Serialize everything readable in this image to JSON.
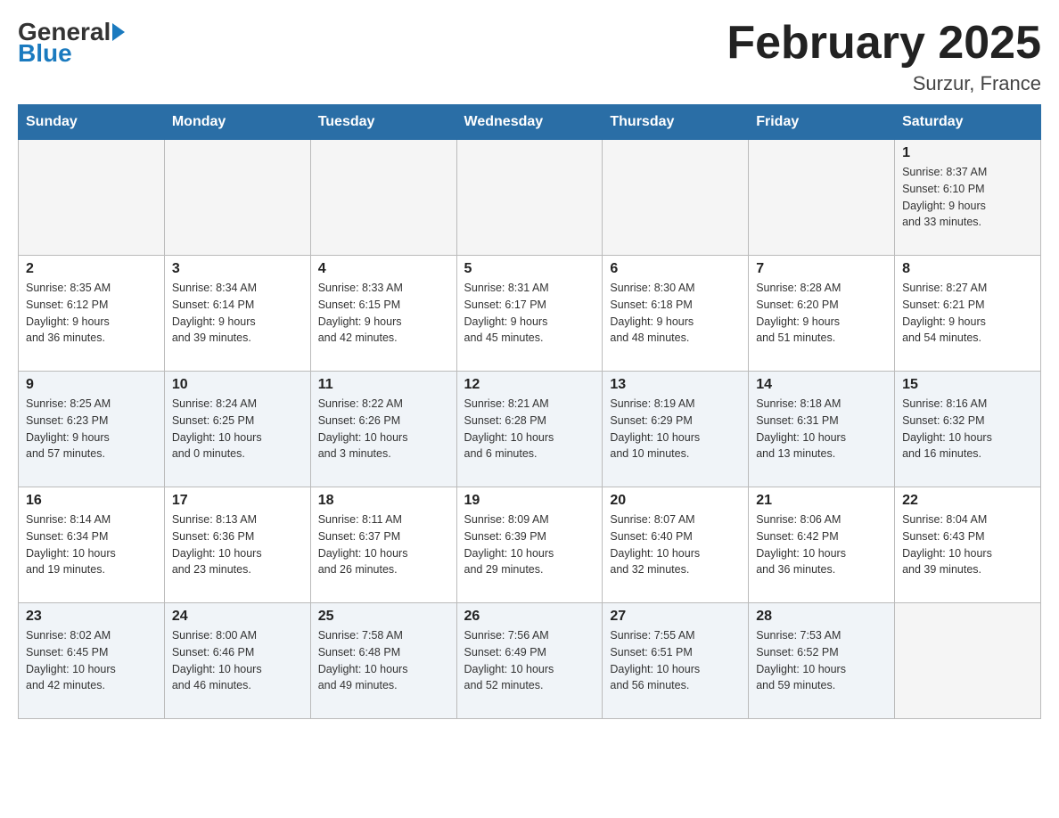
{
  "logo": {
    "general": "General",
    "blue": "Blue"
  },
  "title": "February 2025",
  "subtitle": "Surzur, France",
  "days_of_week": [
    "Sunday",
    "Monday",
    "Tuesday",
    "Wednesday",
    "Thursday",
    "Friday",
    "Saturday"
  ],
  "weeks": [
    {
      "days": [
        {
          "number": "",
          "info": ""
        },
        {
          "number": "",
          "info": ""
        },
        {
          "number": "",
          "info": ""
        },
        {
          "number": "",
          "info": ""
        },
        {
          "number": "",
          "info": ""
        },
        {
          "number": "",
          "info": ""
        },
        {
          "number": "1",
          "info": "Sunrise: 8:37 AM\nSunset: 6:10 PM\nDaylight: 9 hours\nand 33 minutes."
        }
      ]
    },
    {
      "days": [
        {
          "number": "2",
          "info": "Sunrise: 8:35 AM\nSunset: 6:12 PM\nDaylight: 9 hours\nand 36 minutes."
        },
        {
          "number": "3",
          "info": "Sunrise: 8:34 AM\nSunset: 6:14 PM\nDaylight: 9 hours\nand 39 minutes."
        },
        {
          "number": "4",
          "info": "Sunrise: 8:33 AM\nSunset: 6:15 PM\nDaylight: 9 hours\nand 42 minutes."
        },
        {
          "number": "5",
          "info": "Sunrise: 8:31 AM\nSunset: 6:17 PM\nDaylight: 9 hours\nand 45 minutes."
        },
        {
          "number": "6",
          "info": "Sunrise: 8:30 AM\nSunset: 6:18 PM\nDaylight: 9 hours\nand 48 minutes."
        },
        {
          "number": "7",
          "info": "Sunrise: 8:28 AM\nSunset: 6:20 PM\nDaylight: 9 hours\nand 51 minutes."
        },
        {
          "number": "8",
          "info": "Sunrise: 8:27 AM\nSunset: 6:21 PM\nDaylight: 9 hours\nand 54 minutes."
        }
      ]
    },
    {
      "days": [
        {
          "number": "9",
          "info": "Sunrise: 8:25 AM\nSunset: 6:23 PM\nDaylight: 9 hours\nand 57 minutes."
        },
        {
          "number": "10",
          "info": "Sunrise: 8:24 AM\nSunset: 6:25 PM\nDaylight: 10 hours\nand 0 minutes."
        },
        {
          "number": "11",
          "info": "Sunrise: 8:22 AM\nSunset: 6:26 PM\nDaylight: 10 hours\nand 3 minutes."
        },
        {
          "number": "12",
          "info": "Sunrise: 8:21 AM\nSunset: 6:28 PM\nDaylight: 10 hours\nand 6 minutes."
        },
        {
          "number": "13",
          "info": "Sunrise: 8:19 AM\nSunset: 6:29 PM\nDaylight: 10 hours\nand 10 minutes."
        },
        {
          "number": "14",
          "info": "Sunrise: 8:18 AM\nSunset: 6:31 PM\nDaylight: 10 hours\nand 13 minutes."
        },
        {
          "number": "15",
          "info": "Sunrise: 8:16 AM\nSunset: 6:32 PM\nDaylight: 10 hours\nand 16 minutes."
        }
      ]
    },
    {
      "days": [
        {
          "number": "16",
          "info": "Sunrise: 8:14 AM\nSunset: 6:34 PM\nDaylight: 10 hours\nand 19 minutes."
        },
        {
          "number": "17",
          "info": "Sunrise: 8:13 AM\nSunset: 6:36 PM\nDaylight: 10 hours\nand 23 minutes."
        },
        {
          "number": "18",
          "info": "Sunrise: 8:11 AM\nSunset: 6:37 PM\nDaylight: 10 hours\nand 26 minutes."
        },
        {
          "number": "19",
          "info": "Sunrise: 8:09 AM\nSunset: 6:39 PM\nDaylight: 10 hours\nand 29 minutes."
        },
        {
          "number": "20",
          "info": "Sunrise: 8:07 AM\nSunset: 6:40 PM\nDaylight: 10 hours\nand 32 minutes."
        },
        {
          "number": "21",
          "info": "Sunrise: 8:06 AM\nSunset: 6:42 PM\nDaylight: 10 hours\nand 36 minutes."
        },
        {
          "number": "22",
          "info": "Sunrise: 8:04 AM\nSunset: 6:43 PM\nDaylight: 10 hours\nand 39 minutes."
        }
      ]
    },
    {
      "days": [
        {
          "number": "23",
          "info": "Sunrise: 8:02 AM\nSunset: 6:45 PM\nDaylight: 10 hours\nand 42 minutes."
        },
        {
          "number": "24",
          "info": "Sunrise: 8:00 AM\nSunset: 6:46 PM\nDaylight: 10 hours\nand 46 minutes."
        },
        {
          "number": "25",
          "info": "Sunrise: 7:58 AM\nSunset: 6:48 PM\nDaylight: 10 hours\nand 49 minutes."
        },
        {
          "number": "26",
          "info": "Sunrise: 7:56 AM\nSunset: 6:49 PM\nDaylight: 10 hours\nand 52 minutes."
        },
        {
          "number": "27",
          "info": "Sunrise: 7:55 AM\nSunset: 6:51 PM\nDaylight: 10 hours\nand 56 minutes."
        },
        {
          "number": "28",
          "info": "Sunrise: 7:53 AM\nSunset: 6:52 PM\nDaylight: 10 hours\nand 59 minutes."
        },
        {
          "number": "",
          "info": ""
        }
      ]
    }
  ]
}
